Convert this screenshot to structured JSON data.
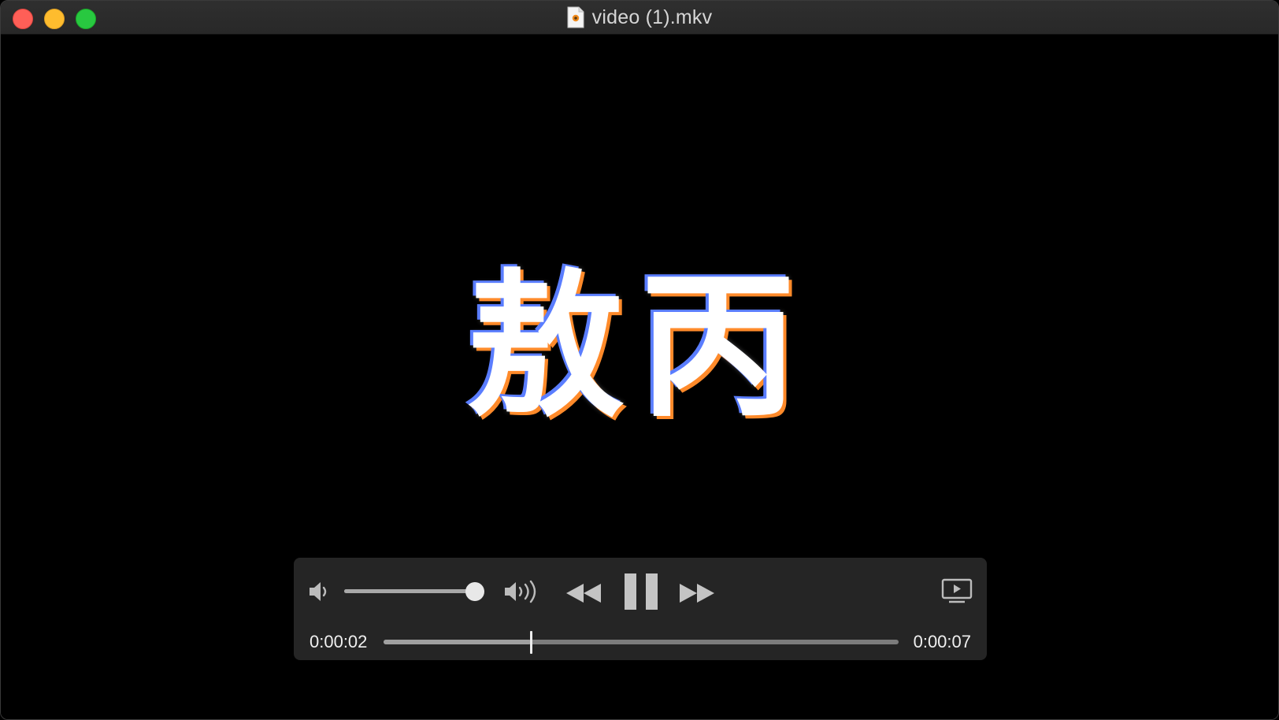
{
  "window": {
    "title": "video (1).mkv",
    "file_icon": "document-icon"
  },
  "video": {
    "subtitle_text": "敖丙"
  },
  "controls": {
    "volume_level": 0.93,
    "playback_progress": 0.2857,
    "current_time": "0:00:02",
    "total_time": "0:00:07",
    "state": "playing",
    "icons": {
      "volume_low": "speaker-low-icon",
      "volume_high": "speaker-high-icon",
      "rewind": "rewind-icon",
      "pause": "pause-icon",
      "fast_forward": "fast-forward-icon",
      "airplay": "airplay-icon"
    }
  },
  "colors": {
    "close": "#ff5f57",
    "minimize": "#febc2e",
    "zoom": "#28c840",
    "hud_background": "#262626"
  }
}
